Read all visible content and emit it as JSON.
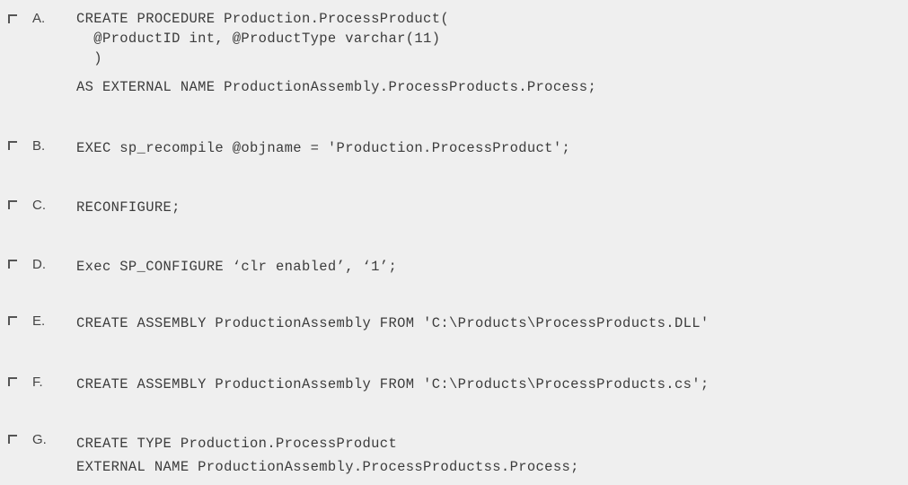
{
  "options": [
    {
      "letter": "A.",
      "lines": [
        "CREATE PROCEDURE Production.ProcessProduct(",
        "  @ProductID int, @ProductType varchar(11)",
        "  )",
        "AS EXTERNAL NAME ProductionAssembly.ProcessProducts.Process;"
      ]
    },
    {
      "letter": "B.",
      "lines": [
        "EXEC sp_recompile @objname = 'Production.ProcessProduct';"
      ]
    },
    {
      "letter": "C.",
      "lines": [
        "RECONFIGURE;"
      ]
    },
    {
      "letter": "D.",
      "lines": [
        "Exec SP_CONFIGURE ‘clr enabled’, ‘1’;"
      ]
    },
    {
      "letter": "E.",
      "lines": [
        "CREATE ASSEMBLY ProductionAssembly FROM 'C:\\Products\\ProcessProducts.DLL'"
      ]
    },
    {
      "letter": "F.",
      "lines": [
        "CREATE ASSEMBLY ProductionAssembly FROM 'C:\\Products\\ProcessProducts.cs';"
      ]
    },
    {
      "letter": "G.",
      "lines": [
        "CREATE TYPE Production.ProcessProduct",
        "EXTERNAL NAME ProductionAssembly.ProcessProductss.Process;"
      ]
    }
  ]
}
